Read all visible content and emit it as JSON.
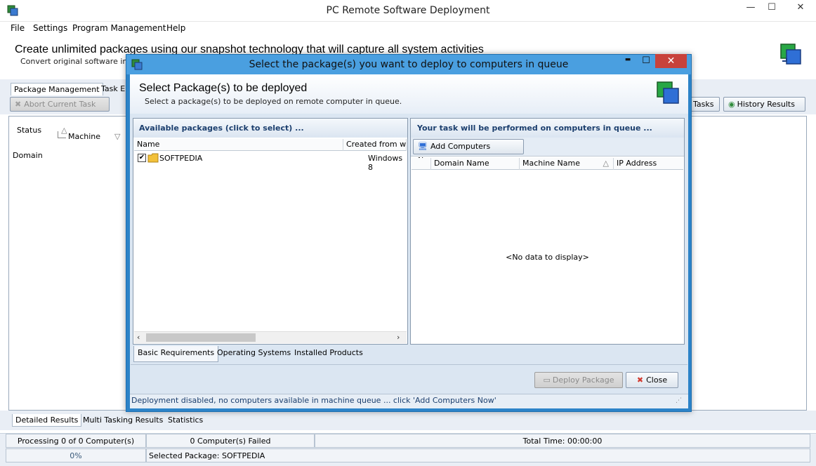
{
  "app": {
    "title": "PC Remote Software Deployment",
    "window_controls": {
      "minimize": "—",
      "maximize": "☐",
      "close": "✕"
    }
  },
  "menu": [
    "File",
    "Settings",
    "Program Management",
    "Help"
  ],
  "banner": {
    "title": "Create unlimited packages using our snapshot technology that will capture all system activities",
    "subtitle": "Convert original software installa"
  },
  "main_tabs": [
    "Package Management",
    "Task E"
  ],
  "toolbar": {
    "abort_label": "Abort Current Task",
    "tasks_label": "Tasks",
    "history_label": "History Results"
  },
  "grid": {
    "status_col": "Status",
    "machine_col": "Machine",
    "domain_col": "Domain"
  },
  "bottom_tabs": [
    "Detailed Results",
    "Multi Tasking Results",
    "Statistics"
  ],
  "status": {
    "processing": "Processing 0 of 0 Computer(s)",
    "failed": "0 Computer(s) Failed",
    "total_time": "Total Time: 00:00:00",
    "progress": "0%",
    "progress_value": 0,
    "selected_package": "Selected Package: SOFTPEDIA"
  },
  "dialog": {
    "title": "Select the package(s) you want to deploy to computers in queue",
    "controls": {
      "minimize": "▬",
      "maximize": "☐",
      "close": "✕"
    },
    "heading": "Select Package(s) to be deployed",
    "subheading": "Select a package(s) to be deployed on remote computer in queue.",
    "left_panel": {
      "title": "Available packages (click to select) ...",
      "columns": [
        "Name",
        "Created from win"
      ],
      "rows": [
        {
          "name": "SOFTPEDIA",
          "created": "Windows 8",
          "checked": true
        }
      ]
    },
    "right_panel": {
      "title": "Your task will be performed on computers in queue ...",
      "add_button": "Add Computers Now",
      "columns": [
        "Domain Name",
        "Machine Name",
        "IP Address"
      ],
      "empty_text": "<No data to display>"
    },
    "lower_tabs": [
      "Basic Requirements",
      "Operating Systems",
      "Installed Products"
    ],
    "deploy_button": "Deploy Package",
    "close_button": "Close",
    "status_text": "Deployment disabled, no computers available in machine queue ... click 'Add Computers Now'"
  },
  "colors": {
    "dialog_border": "#2c83c8",
    "dialog_close": "#c8423b",
    "panel_title": "#1c3f6e"
  }
}
